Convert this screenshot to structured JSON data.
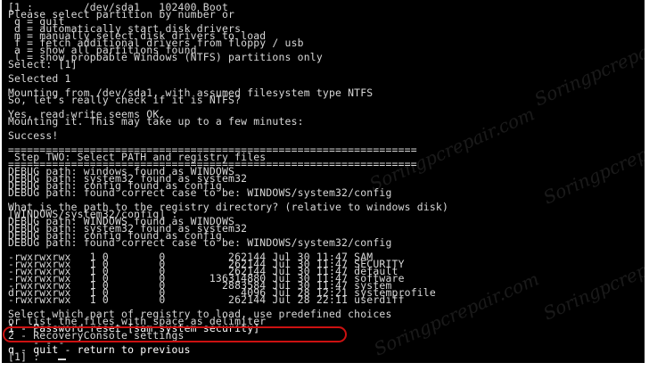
{
  "terminal": {
    "lines": [
      "[1 :        /dev/sda1   102400 Boot",
      "Please select partition by number or",
      " q = quit",
      " d = automatically start disk drivers",
      " m = manually select disk drivers to load",
      " f = fetch additional drivers from floppy / usb",
      " a = show all partitions found",
      " l = show propbable Windows (NTFS) partitions only",
      "Select: [1]",
      "",
      "Selected 1",
      "",
      "Mounting from /dev/sda1, with assumed filesystem type NTFS",
      "So, let's really check if it is NTFS?",
      "",
      "Yes, read-write seems OK.",
      "Mounting it. This may take up to a few minutes:",
      "",
      "Success!",
      "",
      "=================================================================",
      " Step TWO: Select PATH and registry files",
      "=================================================================",
      "DEBUG path: windows found as WINDOWS",
      "DEBUG path: system32 found as system32",
      "DEBUG path: config found as config",
      "DEBUG path: found correct case to be: WINDOWS/system32/config",
      "",
      "What is the path to the registry directory? (relative to windows disk)",
      "[WINDOWS/system32/config] :",
      "DEBUG path: WINDOWS found as WINDOWS",
      "DEBUG path: system32 found as system32",
      "DEBUG path: config found as config",
      "DEBUG path: found correct case to be: WINDOWS/system32/config",
      "",
      "-rwxrwxrwx   1 0        0          262144 Jul 30 11:47 SAM",
      "-rwxrwxrwx   1 0        0          262144 Jul 30 11:47 SECURITY",
      "-rwxrwxrwx   1 0        0          262144 Jul 30 11:47 default",
      "-rwxrwxrwx   1 0        0       136314880 Jul 30 11:47 software",
      "-rwxrwxrwx   1 0        0         2883584 Jul 30 11:47 system",
      "drwxrwxrwx   1 0        0            4096 Jul 28 12:21 systemprofile",
      "-rwxrwxrwx   1 0        0          262144 Jul 28 22:11 userdiff",
      "",
      "Select which part of registry to load, use predefined choices",
      "or list the files with space as delimiter",
      "1 - Password reset [sam system security]",
      "2 - RecoveryConsole settings",
      "    - - -",
      "q - quit - return to previous",
      "[1] : "
    ]
  },
  "watermark": {
    "text": "Soringpcrepair.com"
  }
}
